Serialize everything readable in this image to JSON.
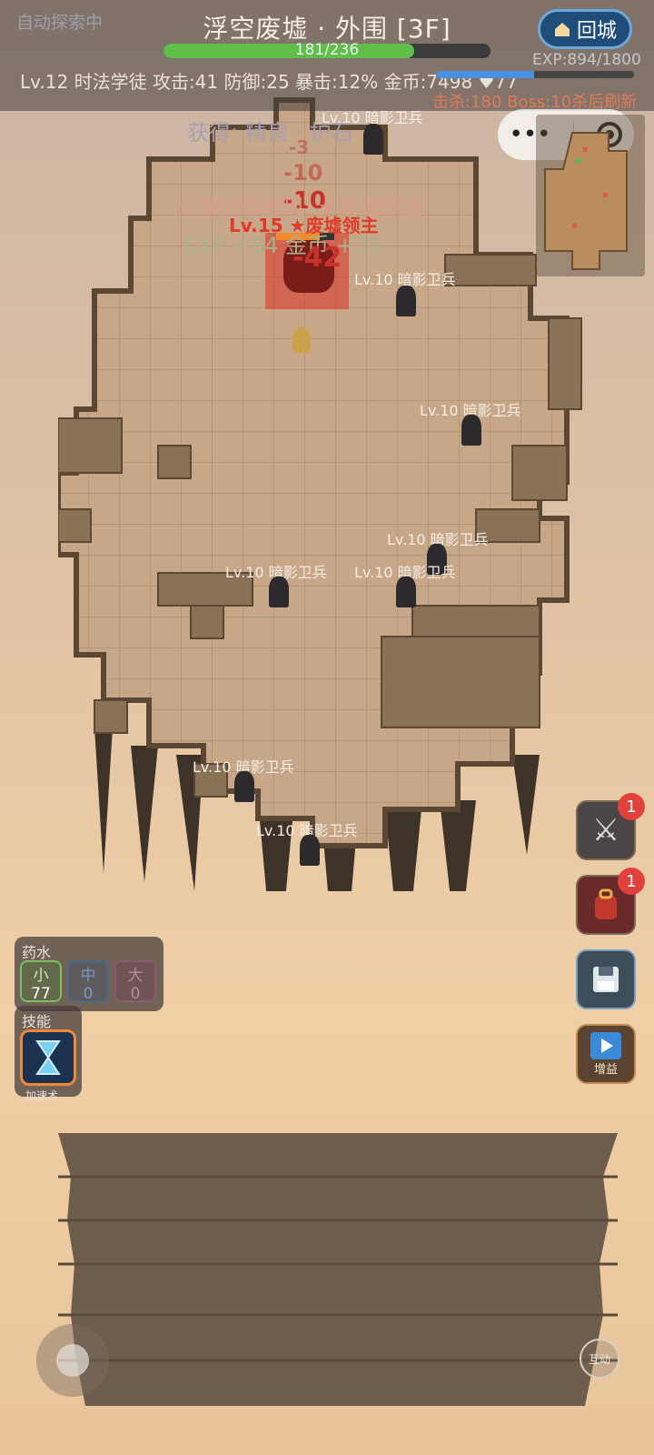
{
  "hud": {
    "auto_explore": "自动探索中",
    "title": "浮空废墟 · 外围 [3F]",
    "hp_text": "181/236",
    "hp_fraction": 0.767,
    "stats": "Lv.12 时法学徒  攻击:41  防御:25  暴击:12%  金币:7498  ♥77",
    "exp_text": "EXP:894/1800",
    "exp_fraction": 0.497,
    "kills": "击杀:180  Boss:10杀后刷新",
    "return_button": "回城",
    "colors": {
      "hp": "#5fbf4a",
      "exp": "#4a90e2",
      "kills": "#e07a55",
      "boss": "#e03a2a"
    }
  },
  "floating_texts": {
    "loot": "获得: 精良 · 护石",
    "damage_1": "-3",
    "damage_2": "-10",
    "damage_3": "-10",
    "boss_warning": "⚠ BOSS出现: ★废墟领主",
    "exp_gain": "EXP +84  金币 +21",
    "boss_hit": "-42"
  },
  "boss": {
    "label": "Lv.15 ★废墟领主",
    "hp_fraction": 0.75
  },
  "monsters": [
    {
      "label": "Lv.10 暗影卫兵"
    },
    {
      "label": "Lv.10 暗影卫兵"
    },
    {
      "label": "Lv.10 暗影卫兵"
    },
    {
      "label": "Lv.10 暗影卫兵"
    },
    {
      "label": "Lv.10 暗影卫兵"
    },
    {
      "label": "Lv.10 暗影卫兵"
    },
    {
      "label": "Lv.10 暗影卫兵"
    },
    {
      "label": "Lv.10 暗影卫兵"
    }
  ],
  "potions": {
    "title": "药水",
    "items": [
      {
        "label": "小",
        "count": "77"
      },
      {
        "label": "中",
        "count": "0"
      },
      {
        "label": "大",
        "count": "0"
      }
    ]
  },
  "skills": {
    "title": "技能",
    "skill_name": "加速术"
  },
  "side_buttons": {
    "equipment_badge": "1",
    "bag_badge": "1",
    "buff_label": "增益"
  },
  "interact_button": "互动",
  "icons": [
    "home-icon",
    "more-dots-icon",
    "record-target-icon",
    "swords-icon",
    "backpack-icon",
    "save-disk-icon",
    "play-icon",
    "hourglass-skill-icon"
  ]
}
